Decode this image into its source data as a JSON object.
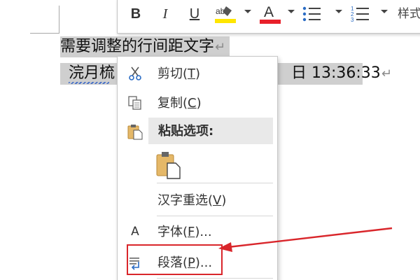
{
  "document": {
    "line1_text": "需要调整的行间距文字",
    "line2_left_text": "浣月梳",
    "line2_right_text": "日 13:36:33",
    "paragraph_mark": "↵"
  },
  "mini_toolbar": {
    "bold_label": "B",
    "italic_label": "I",
    "underline_label": "U",
    "font_color_label": "A",
    "highlight_label": "ab",
    "styles_label": "样式"
  },
  "context_menu": {
    "items": [
      {
        "label": "剪切(",
        "key": "T",
        "suffix": ")",
        "icon": "scissors-icon"
      },
      {
        "label": "复制(",
        "key": "C",
        "suffix": ")",
        "icon": "copy-icon"
      },
      {
        "label": "粘贴选项:",
        "icon": "clipboard-icon"
      },
      {
        "label": "汉字重选(",
        "key": "V",
        "suffix": ")"
      },
      {
        "label": "字体(",
        "key": "F",
        "suffix": ")...",
        "icon": "font-icon"
      },
      {
        "label": "段落(",
        "key": "P",
        "suffix": ")...",
        "icon": "paragraph-icon"
      }
    ],
    "font_icon_glyph": "A"
  },
  "colors": {
    "highlight_yellow": "#ffe600",
    "font_red": "#e8202a",
    "callout_red": "#d9262b",
    "selection_gray": "#cfcfcf"
  }
}
